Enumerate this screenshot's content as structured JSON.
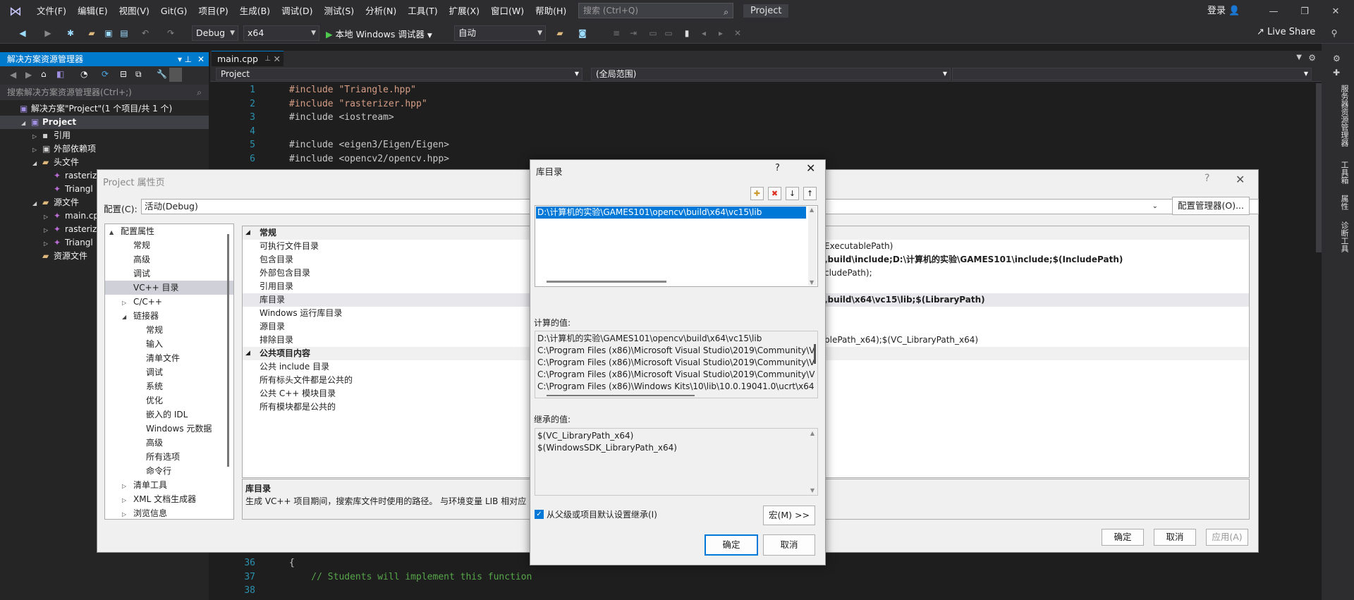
{
  "menu": {
    "items": [
      "文件(F)",
      "编辑(E)",
      "视图(V)",
      "Git(G)",
      "项目(P)",
      "生成(B)",
      "调试(D)",
      "测试(S)",
      "分析(N)",
      "工具(T)",
      "扩展(X)",
      "窗口(W)",
      "帮助(H)"
    ],
    "search_placeholder": "搜索 (Ctrl+Q)",
    "project_badge": "Project",
    "login": "登录"
  },
  "toolbar": {
    "config": "Debug",
    "platform": "x64",
    "run_label": "本地 Windows 调试器",
    "auto": "自动",
    "live_share": "Live Share"
  },
  "solution_explorer": {
    "title": "解决方案资源管理器",
    "search_placeholder": "搜索解决方案资源管理器(Ctrl+;)",
    "rows": [
      {
        "label": "解决方案\"Project\"(1 个项目/共 1 个)",
        "indent": 0
      },
      {
        "label": "Project",
        "indent": 1
      },
      {
        "label": "引用",
        "indent": 2
      },
      {
        "label": "外部依赖项",
        "indent": 2
      },
      {
        "label": "头文件",
        "indent": 2
      },
      {
        "label": "rasteriz",
        "indent": 3
      },
      {
        "label": "Triangl",
        "indent": 3
      },
      {
        "label": "源文件",
        "indent": 2
      },
      {
        "label": "main.cp",
        "indent": 3
      },
      {
        "label": "rasteriz",
        "indent": 3
      },
      {
        "label": "Triangl",
        "indent": 3
      },
      {
        "label": "资源文件",
        "indent": 2
      }
    ]
  },
  "editor": {
    "tab": "main.cpp",
    "nav_project": "Project",
    "nav_scope": "(全局范围)",
    "lines_top": [
      {
        "n": "1",
        "text": "#include \"Triangle.hpp\""
      },
      {
        "n": "2",
        "text": "#include \"rasterizer.hpp\""
      },
      {
        "n": "3",
        "text": "#include <iostream>"
      },
      {
        "n": "4",
        "text": ""
      },
      {
        "n": "5",
        "text": "#include <eigen3/Eigen/Eigen>"
      },
      {
        "n": "6",
        "text": "#include <opencv2/opencv.hpp>"
      }
    ],
    "lines_bottom": [
      {
        "n": "36",
        "text": "{"
      },
      {
        "n": "37",
        "text": "    // Students will implement this function"
      },
      {
        "n": "38",
        "text": ""
      }
    ]
  },
  "right_tabs": [
    "服务器资源管理器",
    "工具箱",
    "属性",
    "诊断工具"
  ],
  "property_pages": {
    "title": "Project 属性页",
    "config_label": "配置(C):",
    "config_value": "活动(Debug)",
    "config_manager": "配置管理器(O)...",
    "tree": [
      {
        "label": "配置属性",
        "indent": 0,
        "exp": "▲"
      },
      {
        "label": "常规",
        "indent": 1
      },
      {
        "label": "高级",
        "indent": 1
      },
      {
        "label": "调试",
        "indent": 1
      },
      {
        "label": "VC++ 目录",
        "indent": 1,
        "sel": true
      },
      {
        "label": "C/C++",
        "indent": 1,
        "exp": "▷"
      },
      {
        "label": "链接器",
        "indent": 1,
        "exp": "◢"
      },
      {
        "label": "常规",
        "indent": 2
      },
      {
        "label": "输入",
        "indent": 2
      },
      {
        "label": "清单文件",
        "indent": 2
      },
      {
        "label": "调试",
        "indent": 2
      },
      {
        "label": "系统",
        "indent": 2
      },
      {
        "label": "优化",
        "indent": 2
      },
      {
        "label": "嵌入的 IDL",
        "indent": 2
      },
      {
        "label": "Windows 元数据",
        "indent": 2
      },
      {
        "label": "高级",
        "indent": 2
      },
      {
        "label": "所有选项",
        "indent": 2
      },
      {
        "label": "命令行",
        "indent": 2
      },
      {
        "label": "清单工具",
        "indent": 1,
        "exp": "▷"
      },
      {
        "label": "XML 文档生成器",
        "indent": 1,
        "exp": "▷"
      },
      {
        "label": "浏览信息",
        "indent": 1,
        "exp": "▷"
      }
    ],
    "grid": [
      {
        "label": "常规",
        "value": "",
        "cat": true
      },
      {
        "label": "可执行文件目录",
        "value": "ExecutablePath)"
      },
      {
        "label": "包含目录",
        "value": ",build\\include;D:\\计算机的实验\\GAMES101\\include;$(IncludePath)",
        "bold": true
      },
      {
        "label": "外部包含目录",
        "value": "cludePath);"
      },
      {
        "label": "引用目录",
        "value": ""
      },
      {
        "label": "库目录",
        "value": ",build\\x64\\vc15\\lib;$(LibraryPath)",
        "bold": true,
        "sel": true
      },
      {
        "label": "Windows 运行库目录",
        "value": ""
      },
      {
        "label": "源目录",
        "value": ""
      },
      {
        "label": "排除目录",
        "value": "blePath_x64);$(VC_LibraryPath_x64)"
      },
      {
        "label": "公共项目内容",
        "value": "",
        "cat": true
      },
      {
        "label": "公共 include 目录",
        "value": ""
      },
      {
        "label": "所有标头文件都是公共的",
        "value": ""
      },
      {
        "label": "公共 C++ 模块目录",
        "value": ""
      },
      {
        "label": "所有模块都是公共的",
        "value": ""
      }
    ],
    "desc_title": "库目录",
    "desc_text": "生成 VC++ 项目期间，搜索库文件时使用的路径。 与环境变量 LIB 相对应",
    "ok": "确定",
    "cancel": "取消",
    "apply": "应用(A)"
  },
  "lib_dialog": {
    "title": "库目录",
    "help": "?",
    "entry": "D:\\计算机的实验\\GAMES101\\opencv\\build\\x64\\vc15\\lib",
    "evaluated_label": "计算的值:",
    "evaluated": [
      "D:\\计算机的实验\\GAMES101\\opencv\\build\\x64\\vc15\\lib",
      "C:\\Program Files (x86)\\Microsoft Visual Studio\\2019\\Community\\V",
      "C:\\Program Files (x86)\\Microsoft Visual Studio\\2019\\Community\\V",
      "C:\\Program Files (x86)\\Microsoft Visual Studio\\2019\\Community\\V",
      "C:\\Program Files (x86)\\Windows Kits\\10\\lib\\10.0.19041.0\\ucrt\\x64"
    ],
    "inherited_label": "继承的值:",
    "inherited": [
      "$(VC_LibraryPath_x64)",
      "$(WindowsSDK_LibraryPath_x64)"
    ],
    "inherit_checkbox": "从父级或项目默认设置继承(I)",
    "macros": "宏(M) >>",
    "ok": "确定",
    "cancel": "取消"
  }
}
